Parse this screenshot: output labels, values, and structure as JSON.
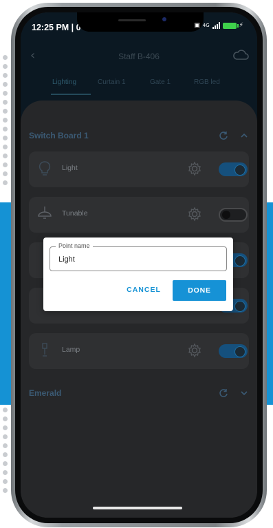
{
  "status_bar": {
    "time": "12:25 PM | 0",
    "network": "4G"
  },
  "app_bar": {
    "title": "Staff B-406"
  },
  "tabs": [
    {
      "label": "Lighting",
      "active": true
    },
    {
      "label": "Curtain 1",
      "active": false
    },
    {
      "label": "Gate 1",
      "active": false
    },
    {
      "label": "RGB led",
      "active": false
    }
  ],
  "groups": [
    {
      "title": "Switch Board 1",
      "expanded": true
    },
    {
      "title": "Emerald",
      "expanded": false
    }
  ],
  "points": [
    {
      "label": "Light",
      "on": true,
      "icon": "bulb-icon"
    },
    {
      "label": "Tunable",
      "on": false,
      "icon": "pendant-lamp-icon"
    },
    {
      "label": "Lamp",
      "on": true,
      "icon": "lamp-icon"
    }
  ],
  "dialog": {
    "field_label": "Point name",
    "field_value": "Light",
    "cancel_label": "CANCEL",
    "done_label": "DONE"
  },
  "colors": {
    "accent": "#1592d4",
    "toggle_on": "#15507d",
    "screen_bg": "#2b2c2e",
    "header_bg": "#0b1822"
  }
}
